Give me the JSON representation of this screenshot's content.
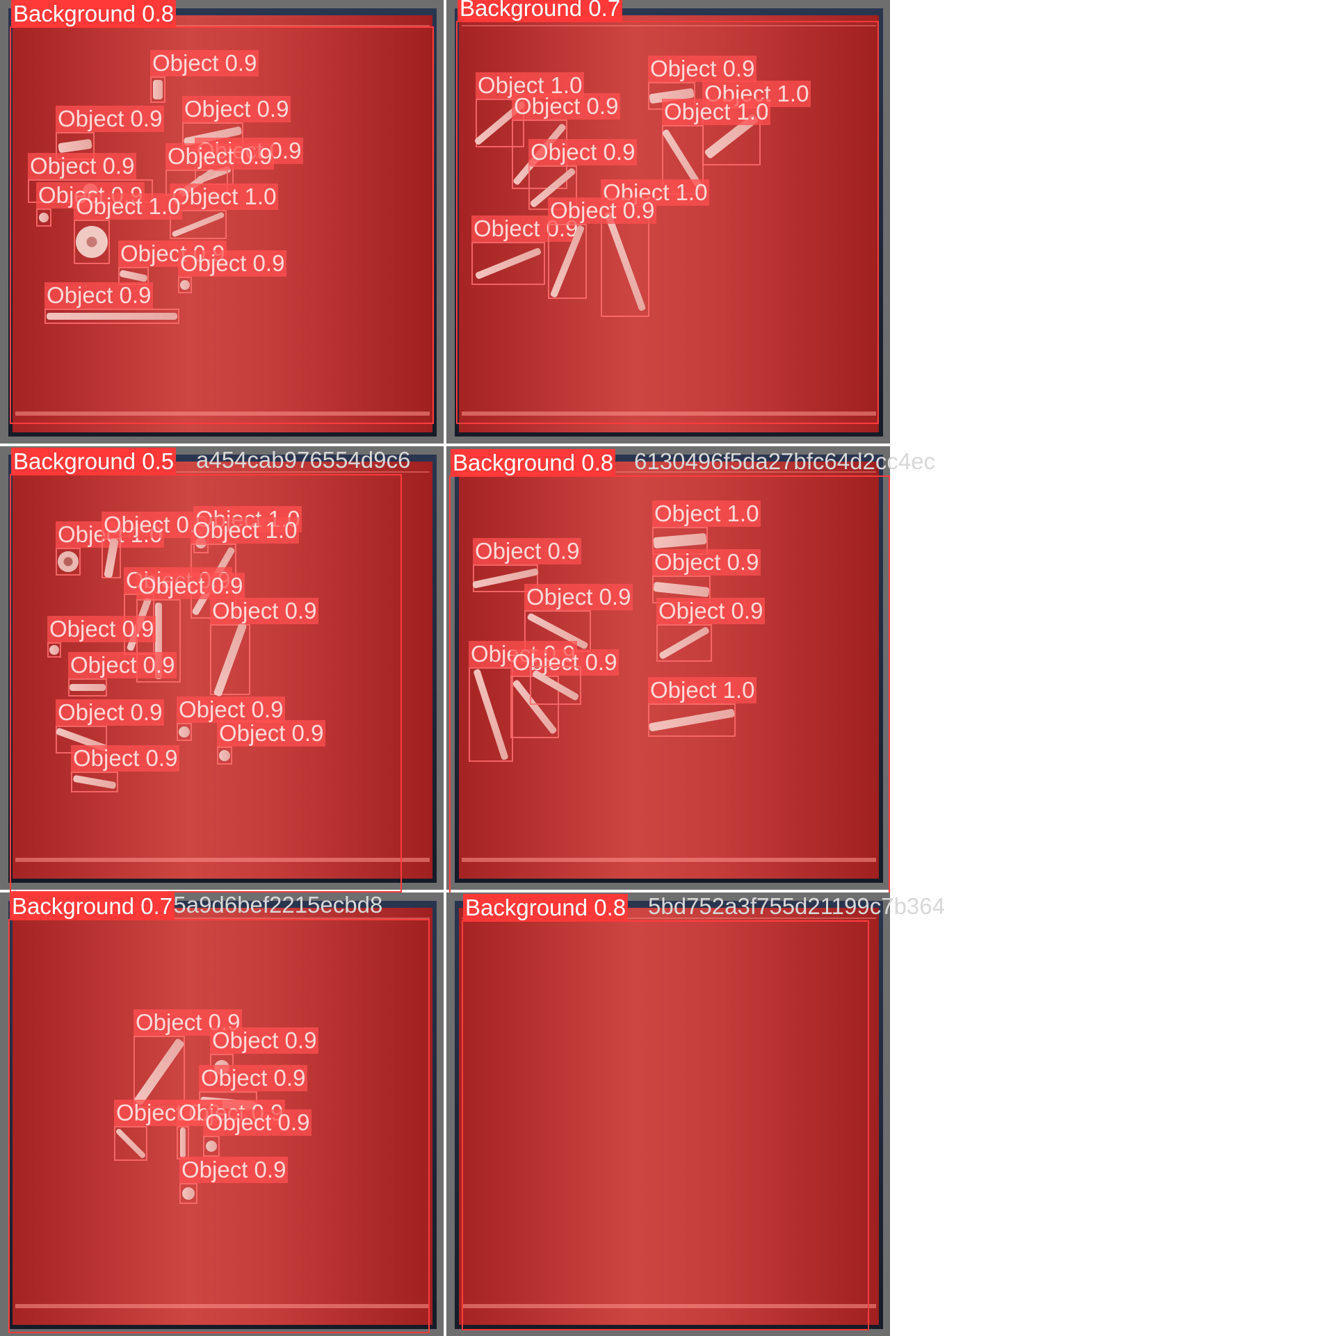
{
  "cells": [
    {
      "background": {
        "label": "Background 0.8"
      },
      "filename": "",
      "objects": [
        {
          "label": "Object 0.9"
        },
        {
          "label": "Object 0.9"
        },
        {
          "label": "Object 0.9"
        },
        {
          "label": "Object 0.9"
        },
        {
          "label": "Object 0.9"
        },
        {
          "label": "Object 0.9"
        },
        {
          "label": "Object 0.9"
        },
        {
          "label": "Object 1.0"
        },
        {
          "label": "Object 1.0"
        },
        {
          "label": "Object 0.9"
        },
        {
          "label": "Object 0.9"
        },
        {
          "label": "Object 0.9"
        }
      ]
    },
    {
      "background": {
        "label": "Background 0.7"
      },
      "filename": "",
      "objects": [
        {
          "label": "Object 0.9"
        },
        {
          "label": "Object 1.0"
        },
        {
          "label": "Object 0.9"
        },
        {
          "label": "Object 1.0"
        },
        {
          "label": "Object 1.0"
        },
        {
          "label": "Object 0.9"
        },
        {
          "label": "Object 1.0"
        },
        {
          "label": "Object 0.9"
        },
        {
          "label": "Object 0.9"
        }
      ]
    },
    {
      "background": {
        "label": "Background 0.5"
      },
      "filename": "a454cab976554d9c6",
      "objects": [
        {
          "label": "Object 1.0"
        },
        {
          "label": "Object 0.9"
        },
        {
          "label": "Object 1.0"
        },
        {
          "label": "Object 1.0"
        },
        {
          "label": "Object 0.9"
        },
        {
          "label": "Object 0.9"
        },
        {
          "label": "Object 0.9"
        },
        {
          "label": "Object 0.9"
        },
        {
          "label": "Object 0.9"
        },
        {
          "label": "Object 0.9"
        },
        {
          "label": "Object 0.9"
        },
        {
          "label": "Object 0.9"
        },
        {
          "label": "Object 0.9"
        }
      ]
    },
    {
      "background": {
        "label": "Background 0.8"
      },
      "filename": "6130496f5da27bfc64d2cc4ec",
      "objects": [
        {
          "label": "Object 1.0"
        },
        {
          "label": "Object 0.9"
        },
        {
          "label": "Object 0.9"
        },
        {
          "label": "Object 0.9"
        },
        {
          "label": "Object 0.9"
        },
        {
          "label": "Object 0.9"
        },
        {
          "label": "Object 0.9"
        },
        {
          "label": "Object 1.0"
        }
      ]
    },
    {
      "background": {
        "label": "Background 0.7"
      },
      "filename": "_jpg.rf.090db945a9d6bef2215ecbd8",
      "objects": [
        {
          "label": "Object 0.9"
        },
        {
          "label": "Object 0.9"
        },
        {
          "label": "Object 0.9"
        },
        {
          "label": "Object 0.9"
        },
        {
          "label": "Object 0.9"
        },
        {
          "label": "Object 0.9"
        },
        {
          "label": "Object 0.9"
        }
      ]
    },
    {
      "background": {
        "label": "Background 0.8"
      },
      "filename": "5bd752a3f755d21199c7b364",
      "objects": []
    }
  ]
}
